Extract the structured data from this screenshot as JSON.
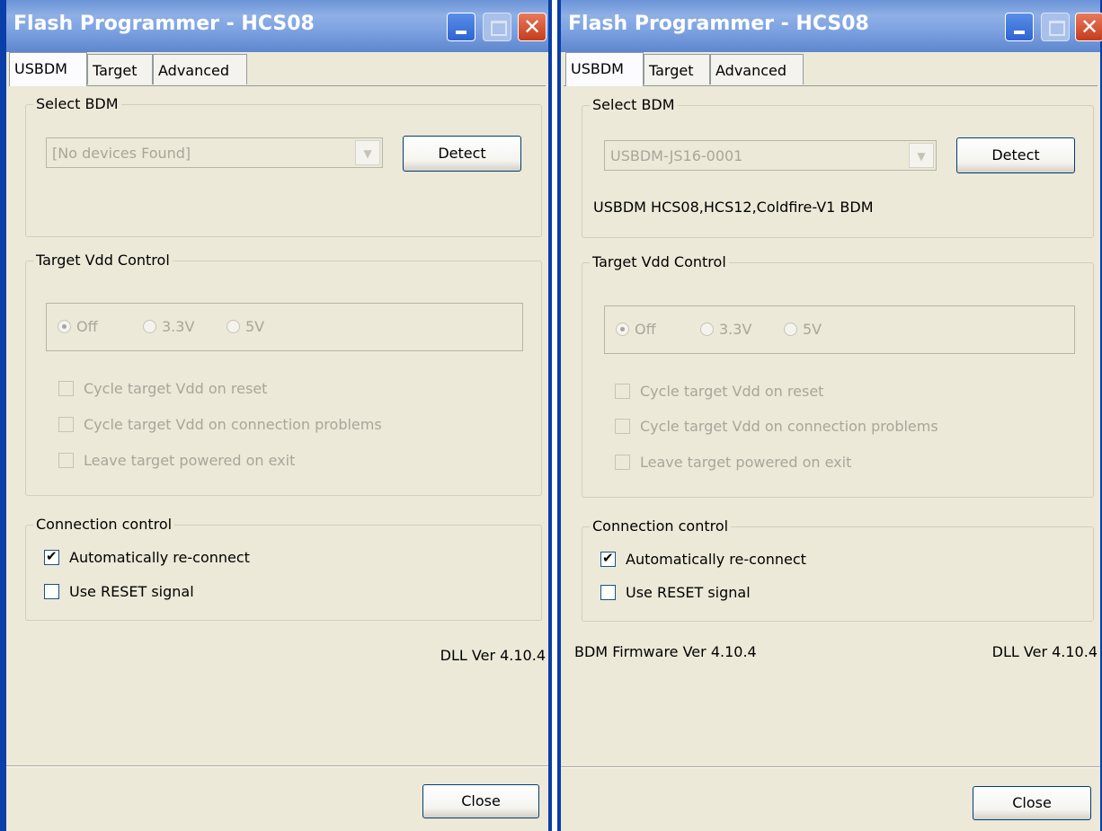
{
  "windows": [
    {
      "title": "Flash Programmer - HCS08",
      "tabs": [
        "USBDM",
        "Target",
        "Advanced"
      ],
      "select_bdm": {
        "group_label": "Select BDM",
        "combo_value": "[No devices Found]",
        "detect_label": "Detect",
        "description": ""
      },
      "vdd": {
        "group_label": "Target Vdd Control",
        "radios": [
          "Off",
          "3.3V",
          "5V"
        ],
        "selected": "Off",
        "checks": [
          {
            "label": "Cycle target Vdd on reset",
            "checked": false
          },
          {
            "label": "Cycle target Vdd on connection problems",
            "checked": false
          },
          {
            "label": "Leave target powered on exit",
            "checked": false
          }
        ]
      },
      "connection": {
        "group_label": "Connection control",
        "checks": [
          {
            "label": "Automatically re-connect",
            "checked": true
          },
          {
            "label": "Use RESET signal",
            "checked": false
          }
        ]
      },
      "firmware_ver": "",
      "dll_ver": "DLL Ver 4.10.4",
      "close_label": "Close"
    },
    {
      "title": "Flash Programmer - HCS08",
      "tabs": [
        "USBDM",
        "Target",
        "Advanced"
      ],
      "select_bdm": {
        "group_label": "Select BDM",
        "combo_value": "USBDM-JS16-0001",
        "detect_label": "Detect",
        "description": "USBDM HCS08,HCS12,Coldfire-V1 BDM"
      },
      "vdd": {
        "group_label": "Target Vdd Control",
        "radios": [
          "Off",
          "3.3V",
          "5V"
        ],
        "selected": "Off",
        "checks": [
          {
            "label": "Cycle target Vdd on reset",
            "checked": false
          },
          {
            "label": "Cycle target Vdd on connection problems",
            "checked": false
          },
          {
            "label": "Leave target powered on exit",
            "checked": false
          }
        ]
      },
      "connection": {
        "group_label": "Connection control",
        "checks": [
          {
            "label": "Automatically re-connect",
            "checked": true
          },
          {
            "label": "Use RESET signal",
            "checked": false
          }
        ]
      },
      "firmware_ver": "BDM Firmware Ver 4.10.4",
      "dll_ver": "DLL Ver 4.10.4",
      "close_label": "Close"
    }
  ],
  "icons": {
    "minimize": "minimize-icon",
    "maximize": "maximize-icon",
    "close": "close-icon",
    "dropdown": "chevron-down-icon",
    "checkmark": "checkmark-icon"
  },
  "colors": {
    "titlebar": "#7ba1e0",
    "frame": "#0a3ea8",
    "dialog_bg": "#ece9d8",
    "close_button": "#c53c1c",
    "disabled_text": "#a7a69a"
  }
}
